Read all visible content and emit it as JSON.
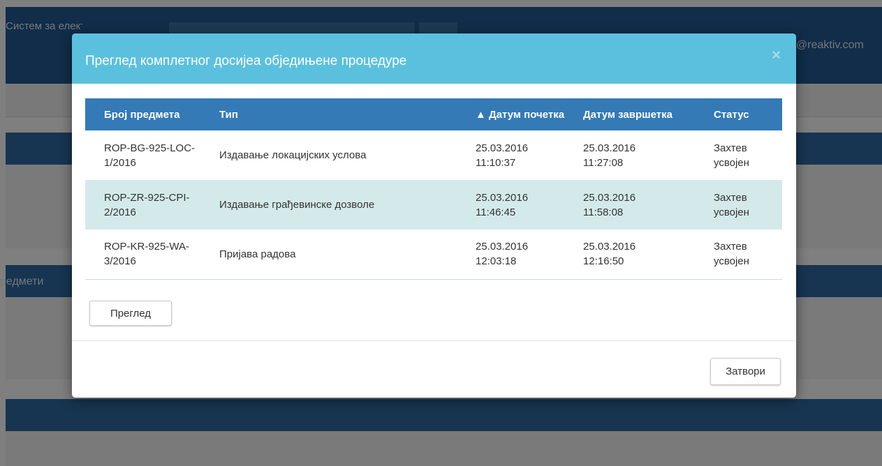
{
  "background": {
    "app_title": "Систем за електронско подношење",
    "user_email": "@reaktiv.com",
    "section_label": "редмети"
  },
  "modal": {
    "title": "Преглед комплетног досијеа обједињене процедуре",
    "close_symbol": "×",
    "table": {
      "columns": [
        "Број предмета",
        "Тип",
        "▲ Датум почетка",
        "Датум завршетка",
        "Статус"
      ],
      "rows": [
        {
          "number": "ROP-BG-925-LOC-1/2016",
          "type": "Издавање локацијских услова",
          "start_date": "25.03.2016",
          "start_time": "11:10:37",
          "end_date": "25.03.2016",
          "end_time": "11:27:08",
          "status": "Захтев усвојен"
        },
        {
          "number": "ROP-ZR-925-CPI-2/2016",
          "type": "Издавање грађевинске дозволе",
          "start_date": "25.03.2016",
          "start_time": "11:46:45",
          "end_date": "25.03.2016",
          "end_time": "11:58:08",
          "status": "Захтев усвојен"
        },
        {
          "number": "ROP-KR-925-WA-3/2016",
          "type": "Пријава радова",
          "start_date": "25.03.2016",
          "start_time": "12:03:18",
          "end_date": "25.03.2016",
          "end_time": "12:16:50",
          "status": "Захтев усвојен"
        }
      ]
    },
    "view_button": "Преглед",
    "close_button": "Затвори"
  },
  "colors": {
    "modal_header": "#5bc0de",
    "table_header": "#337ab7",
    "selected_row": "#d4eaea",
    "page_header": "#235b93"
  }
}
